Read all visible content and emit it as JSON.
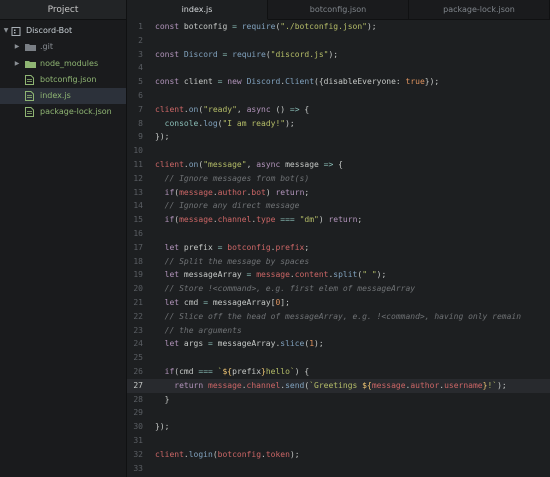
{
  "sidebar": {
    "title": "Project",
    "items": [
      {
        "label": "Discord-Bot",
        "icon": "repo-icon",
        "kind": "root"
      },
      {
        "label": ".git",
        "icon": "folder-icon",
        "kind": "folder-collapsed"
      },
      {
        "label": "node_modules",
        "icon": "folder-icon",
        "kind": "folder-collapsed"
      },
      {
        "label": "botconfig.json",
        "icon": "file-icon",
        "kind": "file"
      },
      {
        "label": "index.js",
        "icon": "file-icon",
        "kind": "file-selected"
      },
      {
        "label": "package-lock.json",
        "icon": "file-icon",
        "kind": "file"
      }
    ]
  },
  "tabs": [
    {
      "label": "index.js",
      "active": true
    },
    {
      "label": "botconfig.json",
      "active": false
    },
    {
      "label": "package-lock.json",
      "active": false
    }
  ],
  "editor": {
    "current_line": 27,
    "lines": [
      "const botconfig = require(\"./botconfig.json\");",
      "",
      "const Discord = require(\"discord.js\");",
      "",
      "const client = new Discord.Client({disableEveryone: true});",
      "",
      "client.on(\"ready\", async () => {",
      "  console.log(\"I am ready!\");",
      "});",
      "",
      "client.on(\"message\", async message => {",
      "  // Ignore messages from bot(s)",
      "  if(message.author.bot) return;",
      "  // Ignore any direct message",
      "  if(message.channel.type === \"dm\") return;",
      "",
      "  let prefix = botconfig.prefix;",
      "  // Split the message by spaces",
      "  let messageArray = message.content.split(\" \");",
      "  // Store !<command>, e.g. first elem of messageArray",
      "  let cmd = messageArray[0];",
      "  // Slice off the head of messageArray, e.g. !<command>, having only remain",
      "  // the arguments",
      "  let args = messageArray.slice(1);",
      "",
      "  if(cmd === `${prefix}hello`) {",
      "    return message.channel.send(`Greetings ${message.author.username}!`);",
      "  }",
      "",
      "});",
      "",
      "client.login(botconfig.token);",
      ""
    ]
  },
  "colors": {
    "keyword": "#b294bb",
    "string": "#b5bd68",
    "variable": "#cc6666",
    "function": "#81a2be",
    "comment": "#6f7275",
    "number": "#de935f",
    "boolean": "#de935f",
    "operator": "#8abeb7",
    "folder_icon": "#8fb573",
    "file_icon": "#8fb573"
  }
}
